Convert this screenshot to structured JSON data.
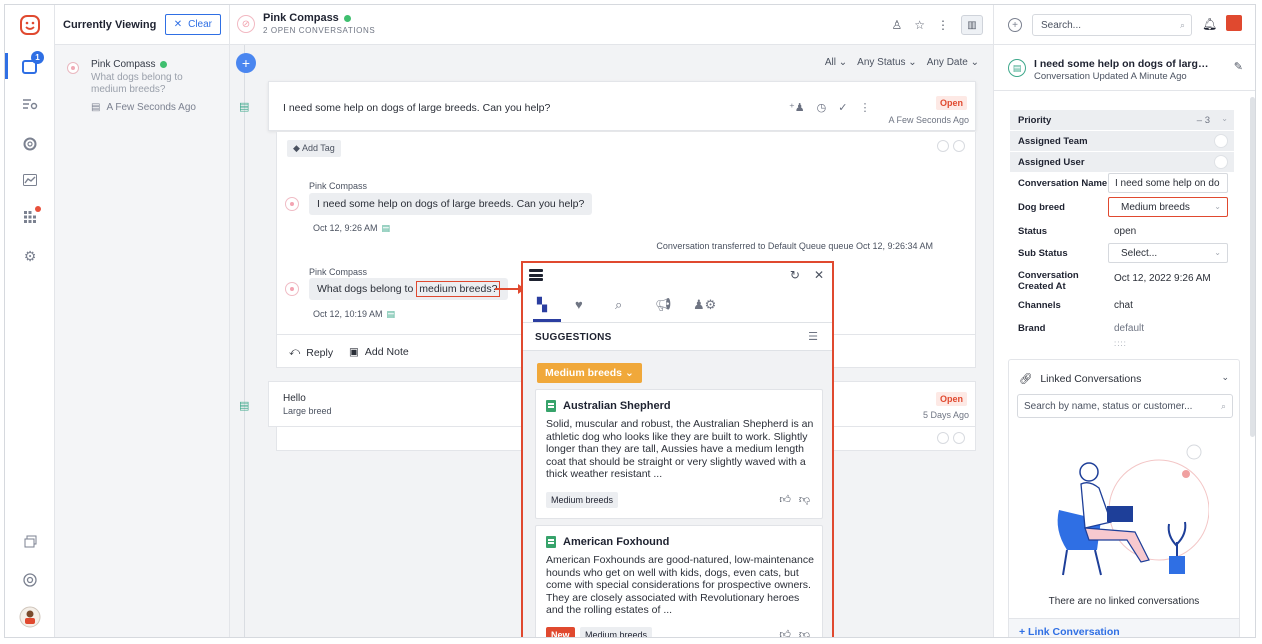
{
  "rail": {
    "notification_count": "1"
  },
  "currently_viewing": {
    "title": "Currently Viewing",
    "clear_label": "Clear",
    "item": {
      "name": "Pink Compass",
      "preview": "What dogs belong to medium breeds?",
      "time": "A Few Seconds Ago"
    }
  },
  "topbar": {
    "title": "Pink Compass",
    "subtitle": "2 OPEN CONVERSATIONS"
  },
  "filters": {
    "all": "All",
    "status": "Any Status",
    "date": "Any Date"
  },
  "conversation1": {
    "message": "I need some help on dogs of large breeds. Can you help?",
    "status": "Open",
    "time": "A Few Seconds Ago",
    "add_tag": "Add Tag",
    "messages": [
      {
        "author": "Pink Compass",
        "text": "I need some help on dogs of large breeds. Can you help?",
        "time": "Oct 12, 9:26 AM"
      },
      {
        "author": "Pink Compass",
        "text_before": "What dogs belong to ",
        "text_highlight": "medium breeds?",
        "time": "Oct 12, 10:19 AM"
      }
    ],
    "system_note": "Conversation transferred to Default Queue queue Oct 12, 9:26:34 AM",
    "reply_label": "Reply",
    "note_label": "Add Note"
  },
  "conversation2": {
    "title": "Hello",
    "subtitle": "Large breed",
    "status": "Open",
    "time": "5 Days Ago"
  },
  "suggestions": {
    "header": "SUGGESTIONS",
    "chip": "Medium breeds",
    "cards": [
      {
        "title": "Australian Shepherd",
        "text": "Solid, muscular and robust, the Australian Shepherd is an athletic dog who looks like they are built to work. Slightly longer than they are tall, Aussies have a medium length coat that should be straight or very slightly waved with a thick weather resistant ...",
        "tag": "Medium breeds"
      },
      {
        "title": "American Foxhound",
        "text": "American Foxhounds are good-natured, low-maintenance hounds who get on well with kids, dogs, even cats, but come with special considerations for prospective owners. They are closely associated with Revolutionary heroes and the rolling estates of ...",
        "new_label": "New",
        "tag": "Medium breeds"
      }
    ]
  },
  "right_panel": {
    "search_placeholder": "Search...",
    "conv_title": "I need some help on dogs of large bre...",
    "conv_sub": "Conversation Updated A Minute Ago",
    "props": {
      "priority_label": "Priority",
      "priority_value": "3",
      "team_label": "Assigned Team",
      "user_label": "Assigned User",
      "name_label": "Conversation Name",
      "name_value": "I need some help on do",
      "breed_label": "Dog breed",
      "breed_value": "Medium breeds",
      "status_label": "Status",
      "status_value": "open",
      "substatus_label": "Sub Status",
      "substatus_value": "Select...",
      "created_label": "Conversation Created At",
      "created_value": "Oct 12, 2022 9:26 AM",
      "channels_label": "Channels",
      "channels_value": "chat",
      "brand_label": "Brand",
      "brand_value": "default"
    },
    "linked": {
      "title": "Linked Conversations",
      "search_placeholder": "Search by name, status or customer...",
      "empty": "There are no linked conversations",
      "link_label": "+ Link Conversation"
    }
  }
}
